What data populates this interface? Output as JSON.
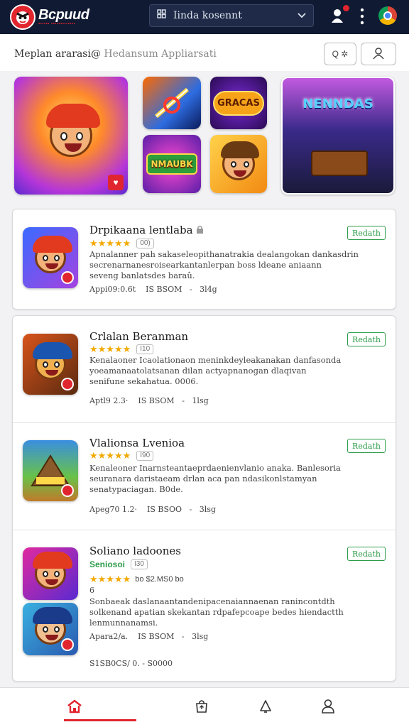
{
  "app": {
    "name": "Bcpuud",
    "tagline": "▪▪▪▪▪▪ ▪▪▪▪▪▪▪▪▪▪▪▪▪",
    "brand_color": "#e0252e",
    "header_color": "#101a33"
  },
  "search": {
    "value": "Iinda kosennt",
    "icon": "grid-icon",
    "dropdown_icon": "chevron-down-icon"
  },
  "toolbar": {
    "account_icon": "user-add-icon",
    "menu_icon": "more-vertical-icon",
    "browser_icon": "chrome-icon"
  },
  "page": {
    "title": "Meplan ararasi@",
    "subtitle": "Hedansum Appliarsati",
    "filter_button": "Q ✲",
    "profile_icon": "person-icon"
  },
  "featured": [
    {
      "label": "",
      "badge": "♥"
    },
    {
      "label": "",
      "badge": ""
    },
    {
      "label": "GRACAS",
      "badge": ""
    },
    {
      "label": "NENNDAS",
      "badge": ""
    },
    {
      "label": "NMAUBK",
      "badge": ""
    },
    {
      "label": "",
      "badge": ""
    }
  ],
  "apps": [
    {
      "name": "Drpikaana lentlaba",
      "lock_icon": "lock-icon",
      "stars": "★★★★★",
      "rating_count": "00)",
      "description": [
        "Apnalanner pah sakaseleopithanatrakia dealangokan dankasdrin",
        "secrenarnanesroisearkantanlerpan boss ldeane aniaann",
        "seveng banlatsdes baraû."
      ],
      "meta": [
        "Appi09:0.6t",
        "IS BSOM",
        "-",
        "3l4g"
      ],
      "install": "Redath"
    },
    {
      "name": "Crlalan Beranman",
      "stars": "★★★★★",
      "rating_count": "I10",
      "description": [
        "Kenalaoner Icaolationaon meninkdeyleakanakan danfasonda",
        "yoeamanaatolatsanan dilan actyapnanogan dlaqivan",
        "senifune sekahatua. 0006."
      ],
      "meta": [
        "Aptl9 2.3·",
        "IS BSOM",
        "-",
        "1lsg"
      ],
      "install": "Redath"
    },
    {
      "name": "Vlalionsa Lvenioa",
      "stars": "★★★★★",
      "rating_count": "I90",
      "description": [
        "Kenaleoner Inarnsteantaeprdaenienvlanio anaka. Banlesoria",
        "seuranara daristaeam drlan aca pan ndasikonlstamyan",
        "senatypaciagan. B0de."
      ],
      "meta": [
        "Apeg70 1.2·",
        "IS BSOO",
        "-",
        "3lsg"
      ],
      "install": "Redath"
    },
    {
      "name": "Soliano ladoones",
      "subname": "Seniosoi",
      "stars": "★★★★★",
      "rating_count": "I30",
      "rating_extra": "bo   $2.MS0 bo",
      "extra_mark": "6",
      "description": [
        "Sonbaeak daslanaantandenipacenaiannaenan ranincontdth",
        "solkenand apatian skekantan rdpafepcoape bedes hiendactth",
        "lenmunnanamsi."
      ],
      "meta": [
        "Apara2/a.",
        "IS BSOM",
        "-",
        "3lsg"
      ],
      "footer": "S1SB0CS/ 0.  -  S0000",
      "install": "Redath"
    }
  ],
  "bottom_nav": [
    {
      "icon": "home-icon",
      "active": true
    },
    {
      "icon": "store-icon",
      "active": false
    },
    {
      "icon": "bell-icon",
      "active": false
    },
    {
      "icon": "profile-icon",
      "active": false
    }
  ]
}
